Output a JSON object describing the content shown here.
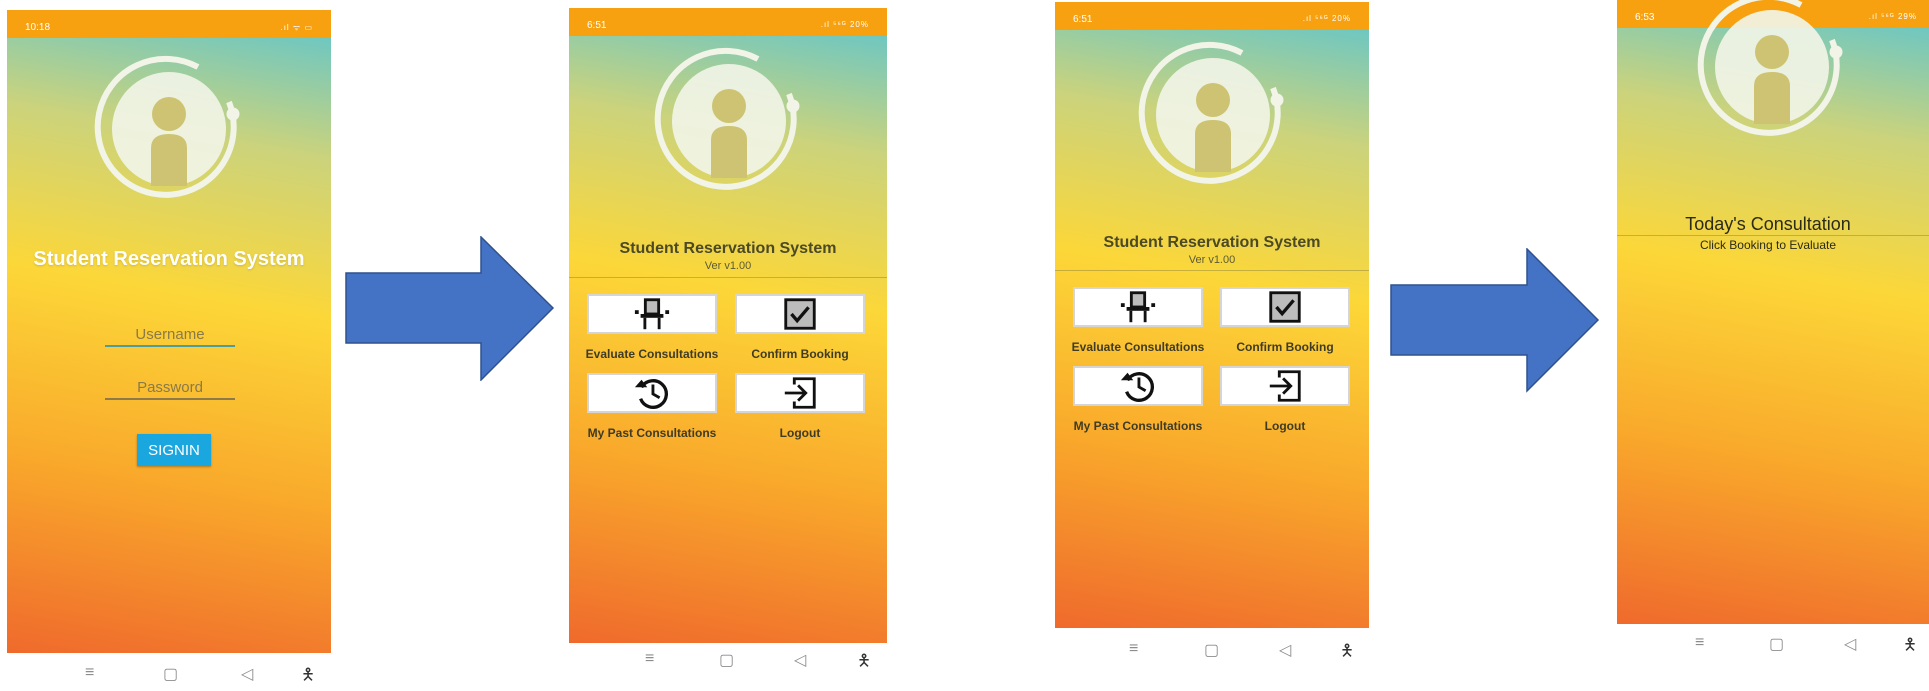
{
  "screen1": {
    "time": "10:18",
    "title": "Student Reservation System",
    "username_placeholder": "Username",
    "password_placeholder": "Password",
    "signin_label": "SIGNIN"
  },
  "screen2": {
    "time": "6:51",
    "title": "Student Reservation System",
    "version": "Ver v1.00",
    "menu": [
      {
        "label": "Evaluate Consultations",
        "icon": "chair-icon"
      },
      {
        "label": "Confirm Booking",
        "icon": "checkbox-icon"
      },
      {
        "label": "My Past Consultations",
        "icon": "history-icon"
      },
      {
        "label": "Logout",
        "icon": "logout-icon"
      }
    ]
  },
  "screen3": {
    "time": "6:51",
    "title": "Student Reservation System",
    "version": "Ver v1.00",
    "menu": [
      {
        "label": "Evaluate Consultations",
        "icon": "chair-icon"
      },
      {
        "label": "Confirm Booking",
        "icon": "checkbox-icon"
      },
      {
        "label": "My Past Consultations",
        "icon": "history-icon"
      },
      {
        "label": "Logout",
        "icon": "logout-icon"
      }
    ]
  },
  "screen4": {
    "time": "6:53",
    "title": "Today's Consultation",
    "subtitle": "Click Booking to Evaluate"
  },
  "colors": {
    "status_bar": "#f8a110",
    "arrow": "#4472c4",
    "signin_button": "#1aa6df"
  }
}
